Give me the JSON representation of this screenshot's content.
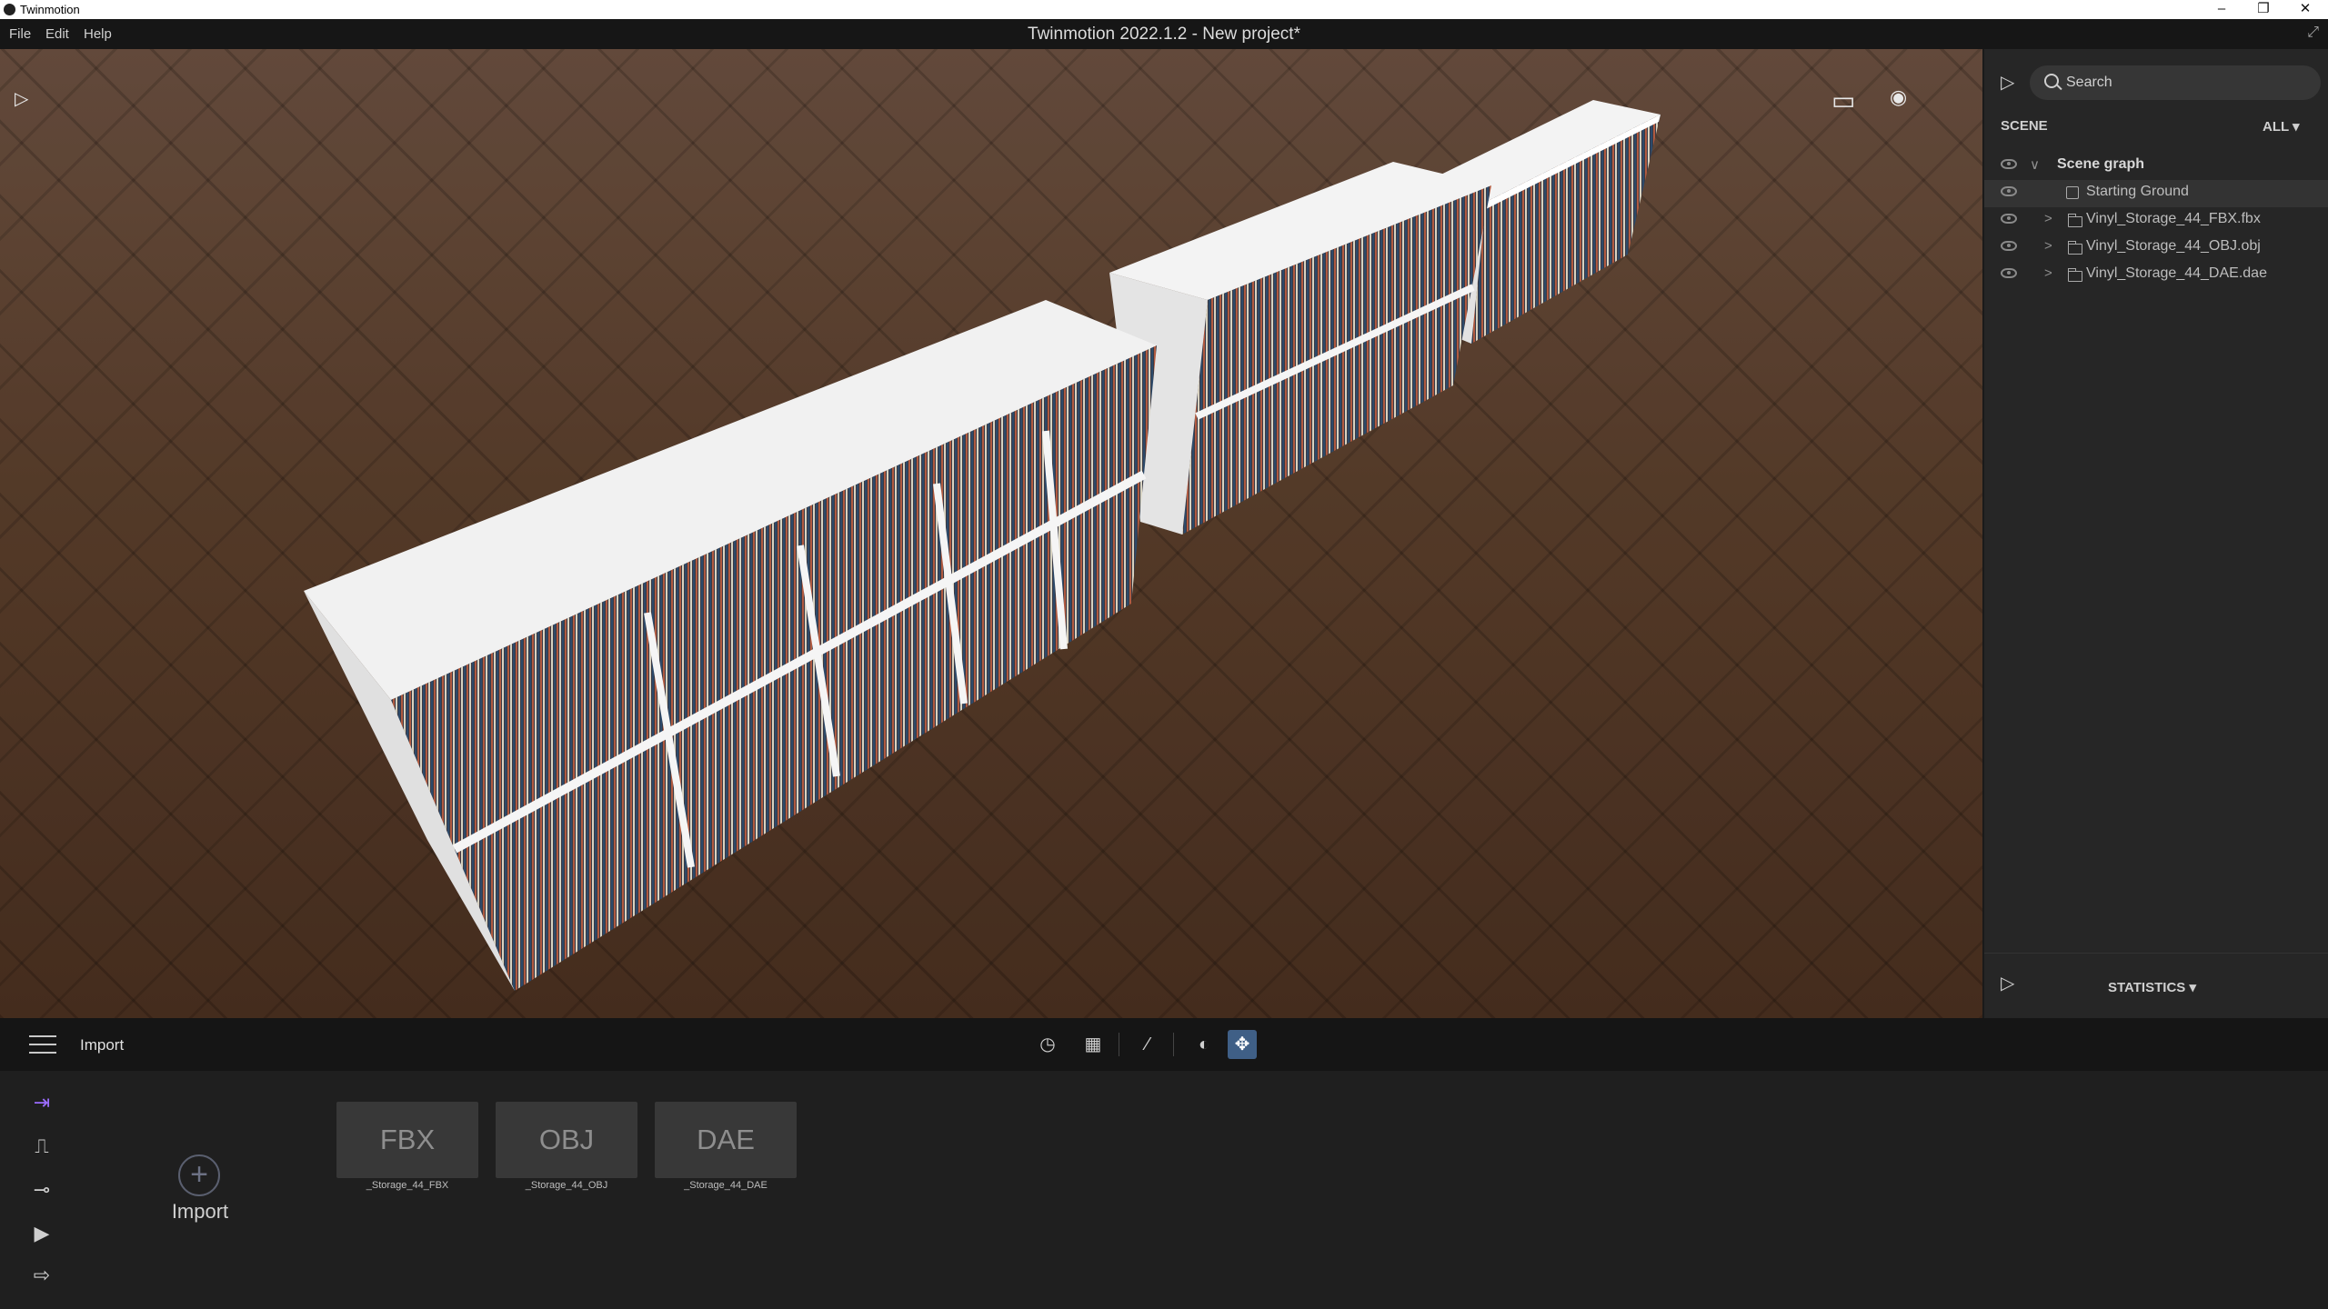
{
  "os_window": {
    "app_name": "Twinmotion",
    "min": "–",
    "restore": "❐",
    "close": "✕"
  },
  "menubar": {
    "items": [
      "File",
      "Edit",
      "Help"
    ],
    "project_title": "Twinmotion 2022.1.2 - New project*",
    "expand_icon": "⤢"
  },
  "viewport": {
    "collapse_icon": "▷",
    "frame_icon": "▭",
    "eye_icon": "◉"
  },
  "scene_panel": {
    "collapse_icon": "▷",
    "search_placeholder": "Search",
    "section": "SCENE",
    "filter": "ALL ▾",
    "tree": [
      {
        "label": "Scene graph",
        "chevron": "∨"
      },
      {
        "label": "Starting Ground",
        "chevron": ""
      },
      {
        "label": "Vinyl_Storage_44_FBX.fbx",
        "chevron": ">"
      },
      {
        "label": "Vinyl_Storage_44_OBJ.obj",
        "chevron": ">"
      },
      {
        "label": "Vinyl_Storage_44_DAE.dae",
        "chevron": ">"
      }
    ],
    "statistics_icon": "▷",
    "statistics_label": "STATISTICS ▾"
  },
  "toolbar": {
    "title": "Import",
    "icons": [
      "◷",
      "▦",
      "⁄",
      "◐",
      "✥"
    ]
  },
  "bottom": {
    "sidebar_icons": [
      "⇥",
      "⎍",
      "⊸",
      "▶",
      "⇨"
    ],
    "import_plus": "+",
    "import_label": "Import",
    "files": [
      {
        "type": "FBX",
        "caption": "_Storage_44_FBX"
      },
      {
        "type": "OBJ",
        "caption": "_Storage_44_OBJ"
      },
      {
        "type": "DAE",
        "caption": "_Storage_44_DAE"
      }
    ]
  },
  "colors": {
    "accent_selected_tool": "#3f5f86",
    "active_side_icon": "#9b6cff",
    "panel_bg": "#262626",
    "floor_wood": "#5b3f2c",
    "shelf_white": "#f2f2f2"
  }
}
